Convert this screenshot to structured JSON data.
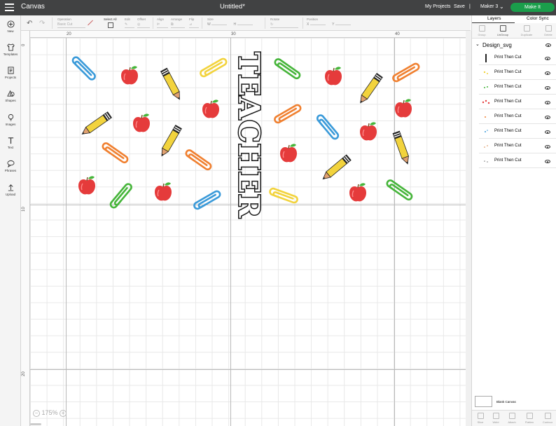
{
  "topbar": {
    "app_name": "Canvas",
    "document_title": "Untitled*",
    "my_projects": "My Projects",
    "save": "Save",
    "divider": "|",
    "machine": "Maker 3",
    "make_it": "Make It"
  },
  "toolbar": {
    "operation_label": "Operation",
    "operation_value": "Basic Cut",
    "select_all": "Select All",
    "edit": "Edit",
    "offset": "Offset",
    "align": "Align",
    "arrange": "Arrange",
    "flip": "Flip",
    "size": "Size",
    "w": "W",
    "h": "H",
    "rotate": "Rotate",
    "position": "Position",
    "x": "X",
    "y": "Y"
  },
  "leftbar": [
    {
      "label": "New",
      "icon": "plus-circle-icon"
    },
    {
      "label": "Templates",
      "icon": "tshirt-icon"
    },
    {
      "label": "Projects",
      "icon": "projects-icon"
    },
    {
      "label": "Shapes",
      "icon": "shapes-icon"
    },
    {
      "label": "Images",
      "icon": "lightbulb-icon"
    },
    {
      "label": "Text",
      "icon": "text-icon"
    },
    {
      "label": "Phrases",
      "icon": "speech-bubble-icon"
    },
    {
      "label": "Upload",
      "icon": "upload-icon"
    }
  ],
  "rulers": {
    "top": [
      "20",
      "30",
      "40"
    ],
    "left": [
      "0",
      "10",
      "20"
    ]
  },
  "canvas": {
    "design_text": "TEACHER"
  },
  "zoom": {
    "level": "175%",
    "minus": "−",
    "plus": "+"
  },
  "panel": {
    "tabs": [
      "Layers",
      "Color Sync"
    ],
    "actions": [
      "Group",
      "UnGroup",
      "Duplicate",
      "Delete"
    ],
    "group_name": "Design_svg",
    "layers": [
      {
        "name": "Print Then Cut",
        "color": "#222222"
      },
      {
        "name": "Print Then Cut",
        "color": "#f2d33d"
      },
      {
        "name": "Print Then Cut",
        "color": "#46b53a"
      },
      {
        "name": "Print Then Cut",
        "color": "#e53b3b"
      },
      {
        "name": "Print Then Cut",
        "color": "#f08030"
      },
      {
        "name": "Print Then Cut",
        "color": "#3a9ad9"
      },
      {
        "name": "Print Then Cut",
        "color": "#e0a070"
      },
      {
        "name": "Print Then Cut",
        "color": "#7a7a7a"
      }
    ],
    "blank_canvas": "Blank Canvas",
    "bottom_actions": [
      "Slice",
      "Weld",
      "Attach",
      "Flatten",
      "Contour"
    ]
  },
  "colors": {
    "topbar": "#414243",
    "make_it": "#1a9e4b",
    "apple": "#e53b3b",
    "leaf": "#46b53a",
    "pencil": "#f2d33d",
    "clip_blue": "#3a9ad9",
    "clip_orange": "#f08030",
    "clip_green": "#46b53a",
    "clip_yellow": "#f2d33d"
  }
}
